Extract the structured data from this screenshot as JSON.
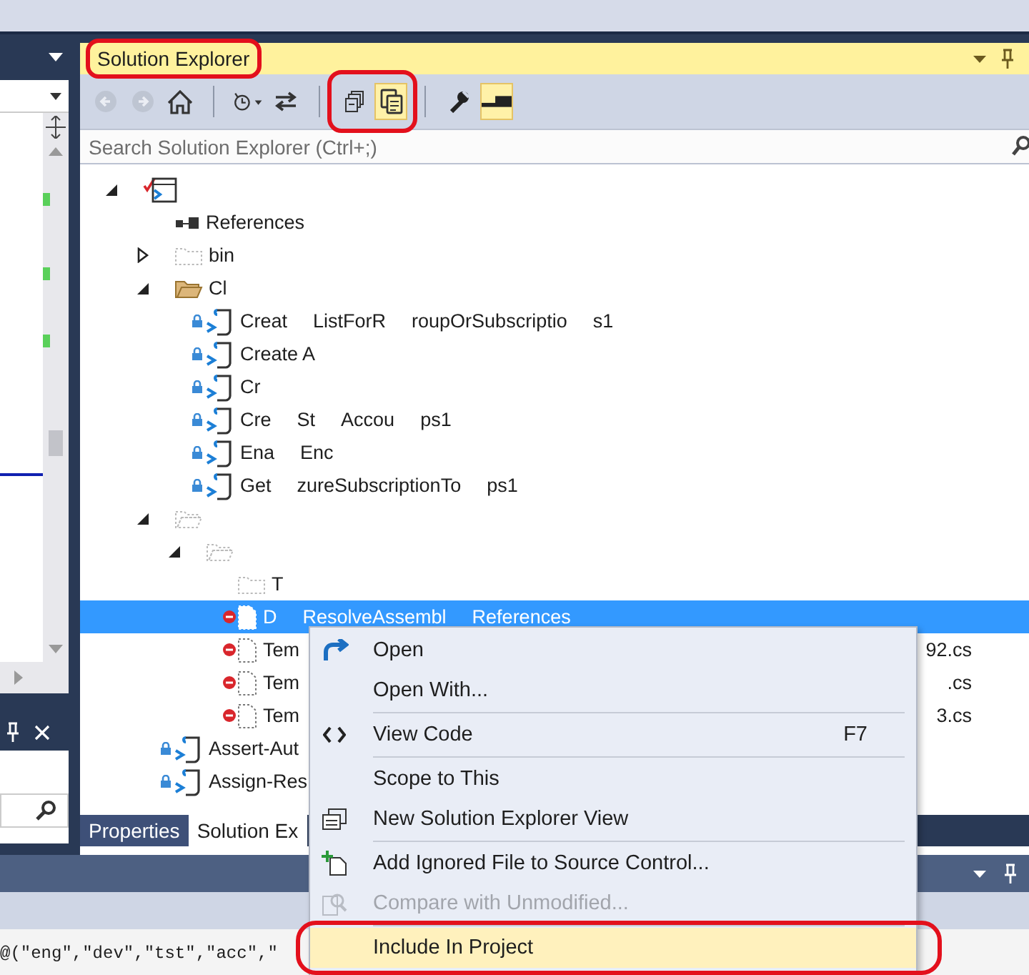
{
  "solution_explorer": {
    "title": {
      "text": "Solution Explorer",
      "circled": true
    },
    "toolbar": [
      {
        "circled": false,
        "buttons": [
          {
            "kind": "back",
            "disabled": true,
            "pressed": false
          },
          {
            "kind": "forward",
            "disabled": true,
            "pressed": false
          },
          {
            "kind": "home",
            "disabled": false,
            "pressed": false
          }
        ]
      },
      {
        "circled": false,
        "buttons": [
          {
            "kind": "history",
            "disabled": false,
            "pressed": false
          },
          {
            "kind": "sync",
            "disabled": false,
            "pressed": false
          }
        ]
      },
      {
        "circled": true,
        "buttons": [
          {
            "kind": "collapse",
            "disabled": false,
            "pressed": false
          },
          {
            "kind": "show-all",
            "disabled": false,
            "pressed": true
          }
        ]
      },
      {
        "circled": false,
        "buttons": [
          {
            "kind": "properties",
            "disabled": false,
            "pressed": false
          },
          {
            "kind": "preview",
            "disabled": false,
            "pressed": true
          }
        ]
      }
    ],
    "search": {
      "placeholder": "Search Solution Explorer (Ctrl+;)"
    },
    "tree": [
      {
        "kind": "project",
        "expanded": true,
        "excluded": false,
        "selected": false,
        "children": [
          {
            "kind": "references",
            "fragments": [
              "References"
            ],
            "excluded": false,
            "selected": false
          },
          {
            "kind": "folder",
            "fragments": [
              "bin"
            ],
            "expanded": false,
            "excluded": true,
            "selected": false
          },
          {
            "kind": "folder",
            "fragments": [
              "Cl"
            ],
            "expanded": true,
            "excluded": false,
            "selected": false,
            "children": [
              {
                "kind": "script",
                "fragments": [
                  "Creat",
                  "ListForR",
                  "roupOrSubscriptio",
                  "s1"
                ],
                "excluded": false,
                "selected": false
              },
              {
                "kind": "script",
                "fragments": [
                  "Create A"
                ],
                "excluded": false,
                "selected": false
              },
              {
                "kind": "script",
                "fragments": [
                  "Cr"
                ],
                "excluded": false,
                "selected": false
              },
              {
                "kind": "script",
                "fragments": [
                  "Cre",
                  "St",
                  "Accou",
                  "ps1"
                ],
                "excluded": false,
                "selected": false
              },
              {
                "kind": "script",
                "fragments": [
                  "Ena",
                  "Enc"
                ],
                "excluded": false,
                "selected": false
              },
              {
                "kind": "script",
                "fragments": [
                  "Get",
                  "zureSubscriptionTo",
                  "ps1"
                ],
                "excluded": false,
                "selected": false
              }
            ]
          },
          {
            "kind": "folder",
            "expanded": true,
            "excluded": true,
            "selected": false,
            "children": [
              {
                "kind": "folder",
                "expanded": true,
                "excluded": true,
                "selected": false,
                "children": [
                  {
                    "kind": "folder",
                    "fragments": [
                      "T"
                    ],
                    "excluded": true,
                    "selected": false
                  },
                  {
                    "kind": "file",
                    "fragments": [
                      "D",
                      "ResolveAssembl",
                      "References"
                    ],
                    "excluded": true,
                    "selected": true
                  },
                  {
                    "kind": "file",
                    "fragments": [
                      "Tem"
                    ],
                    "tail": "92.cs",
                    "excluded": true,
                    "selected": false
                  },
                  {
                    "kind": "file",
                    "fragments": [
                      "Tem"
                    ],
                    "tail": ".cs",
                    "excluded": true,
                    "selected": false
                  },
                  {
                    "kind": "file",
                    "fragments": [
                      "Tem"
                    ],
                    "tail": "3.cs",
                    "excluded": true,
                    "selected": false
                  }
                ]
              }
            ]
          },
          {
            "kind": "script",
            "fragments": [
              "Assert-Aut"
            ],
            "excluded": false,
            "selected": false
          },
          {
            "kind": "script",
            "fragments": [
              "Assign-Res"
            ],
            "excluded": false,
            "selected": false
          }
        ]
      }
    ],
    "tabs": [
      {
        "label": "Properties",
        "selected": false
      },
      {
        "label": "Solution Ex",
        "selected": true
      }
    ]
  },
  "code_line": "@(\"eng\",\"dev\",\"tst\",\"acc\",\"",
  "context_menu": [
    [
      {
        "label": "Open",
        "disabled": false,
        "highlighted": false,
        "circled": false
      },
      {
        "label": "Open With...",
        "disabled": false,
        "highlighted": false,
        "circled": false
      }
    ],
    [
      {
        "label": "View Code",
        "shortcut": "F7",
        "disabled": false,
        "highlighted": false,
        "circled": false
      }
    ],
    [
      {
        "label": "Scope to This",
        "disabled": false,
        "highlighted": false,
        "circled": false
      },
      {
        "label": "New Solution Explorer View",
        "disabled": false,
        "highlighted": false,
        "circled": false
      }
    ],
    [
      {
        "label": "Add Ignored File to Source Control...",
        "disabled": false,
        "highlighted": false,
        "circled": false
      },
      {
        "label": "Compare with Unmodified...",
        "disabled": true,
        "highlighted": false,
        "circled": false
      }
    ],
    [
      {
        "label": "Include In Project",
        "disabled": false,
        "highlighted": true,
        "circled": true
      }
    ]
  ]
}
